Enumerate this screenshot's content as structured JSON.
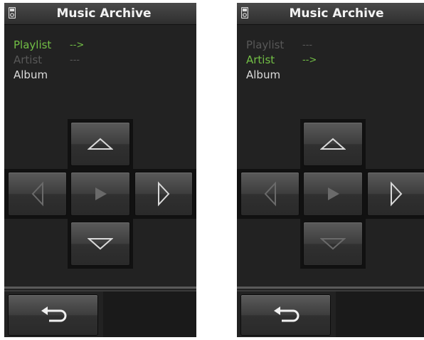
{
  "screens": [
    {
      "title": "Music Archive",
      "menu": [
        {
          "label": "Playlist",
          "arrow": "-->",
          "state": "active"
        },
        {
          "label": "Artist",
          "arrow": "---",
          "state": "dim"
        },
        {
          "label": "Album",
          "arrow": "",
          "state": "normal"
        }
      ],
      "dpad": {
        "up": "enabled",
        "left": "disabled",
        "center": "disabled",
        "right": "enabled",
        "down": "enabled"
      }
    },
    {
      "title": "Music Archive",
      "menu": [
        {
          "label": "Playlist",
          "arrow": "---",
          "state": "dim"
        },
        {
          "label": "Artist",
          "arrow": "-->",
          "state": "active"
        },
        {
          "label": "Album",
          "arrow": "",
          "state": "normal"
        }
      ],
      "dpad": {
        "up": "enabled",
        "left": "disabled",
        "center": "disabled",
        "right": "enabled",
        "down": "disabled"
      }
    }
  ],
  "icons": {
    "device": "media-player-icon",
    "up": "triangle-up-icon",
    "left": "triangle-left-icon",
    "center": "play-icon",
    "right": "triangle-right-icon",
    "down": "triangle-down-icon",
    "back": "return-arrow-icon"
  },
  "colors": {
    "active": "#72bf45",
    "dim": "#585858",
    "normal": "#dcdcdc",
    "icon_enabled": "#d9d9d9",
    "icon_disabled": "#6a6a6a"
  }
}
